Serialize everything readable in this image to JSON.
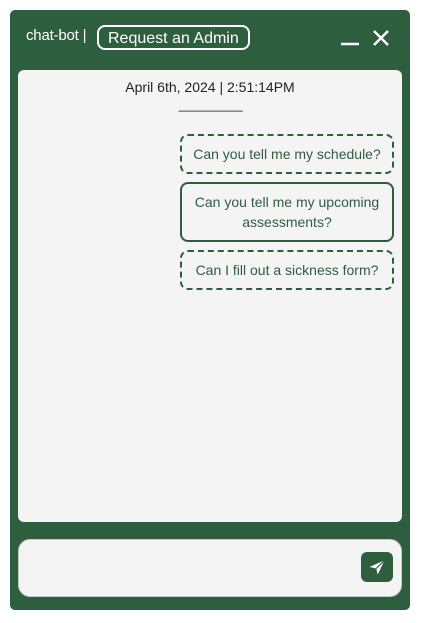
{
  "header": {
    "title": "chat-bot |",
    "admin_button_label": "Request an Admin",
    "minimize_icon": "minimize-icon",
    "close_icon": "close-icon"
  },
  "chat": {
    "timestamp": "April 6th, 2024 | 2:51:14PM",
    "divider": "------------------------------",
    "suggestions": [
      {
        "label": "Can you tell me my schedule?",
        "border": "dashed"
      },
      {
        "label": "Can you tell me my upcoming assessments?",
        "border": "solid"
      },
      {
        "label": "Can I fill out a sickness form?",
        "border": "dashed"
      }
    ]
  },
  "composer": {
    "input_value": "",
    "send_icon": "send-icon"
  },
  "colors": {
    "brand": "#2d5e3e",
    "panel": "#f4f4f4",
    "text": "#222222"
  }
}
